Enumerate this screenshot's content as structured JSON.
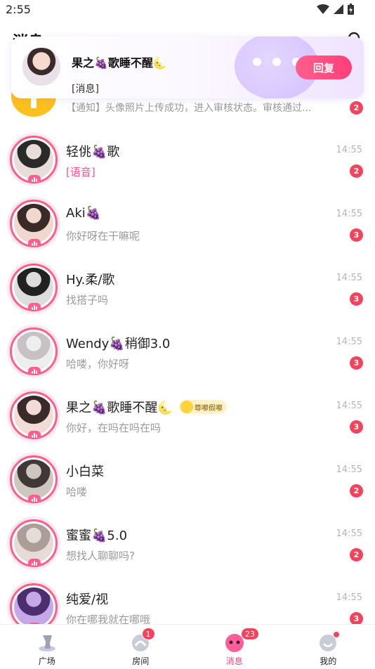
{
  "status_bar": {
    "time": "2:55"
  },
  "header": {
    "title": "消息"
  },
  "notification": {
    "name": "果之🍇歌睡不醒🌜",
    "preview": "[消息]",
    "reply_label": "回复"
  },
  "system_row": {
    "message": "【通知】头像照片上传成功，进入审核状态。审核通过...",
    "badge": "2"
  },
  "conversations": [
    {
      "name": "轻佻🍇歌",
      "message": "[语音]",
      "time": "14:55",
      "badge": "2"
    },
    {
      "name": "Aki🍇",
      "message": "你好呀在干嘛呢",
      "time": "14:55",
      "badge": "3"
    },
    {
      "name": "Hy.柔/歌",
      "message": "找搭子吗",
      "time": "14:55",
      "badge": "3"
    },
    {
      "name": "Wendy🍇稍御3.0",
      "message": "哈喽，你好呀",
      "time": "14:55",
      "badge": "3"
    },
    {
      "name": "果之🍇歌睡不醒🌜",
      "tag": "尊嘟假嘟",
      "message": "你好，在吗在吗在吗",
      "time": "14:55",
      "badge": "3"
    },
    {
      "name": "小白菜",
      "message": "哈喽",
      "time": "14:55",
      "badge": "2"
    },
    {
      "name": "蜜蜜🍇5.0",
      "message": "想找人聊聊吗?",
      "time": "14:55",
      "badge": "2"
    },
    {
      "name": "纯爱/视",
      "message": "你在哪我就在哪哦",
      "time": "14:55",
      "badge": "3"
    }
  ],
  "nav": {
    "items": [
      {
        "label": "广场",
        "icon": "plaza-icon"
      },
      {
        "label": "房间",
        "icon": "room-icon",
        "badge": "1"
      },
      {
        "label": "消息",
        "icon": "message-icon",
        "badge": "23",
        "active": true
      },
      {
        "label": "我的",
        "icon": "profile-icon"
      }
    ]
  },
  "colors": {
    "accent": "#ff3f78",
    "badge": "#f2445c",
    "ring": "#ff5d8c",
    "system_icon": "#ffbf1d"
  }
}
